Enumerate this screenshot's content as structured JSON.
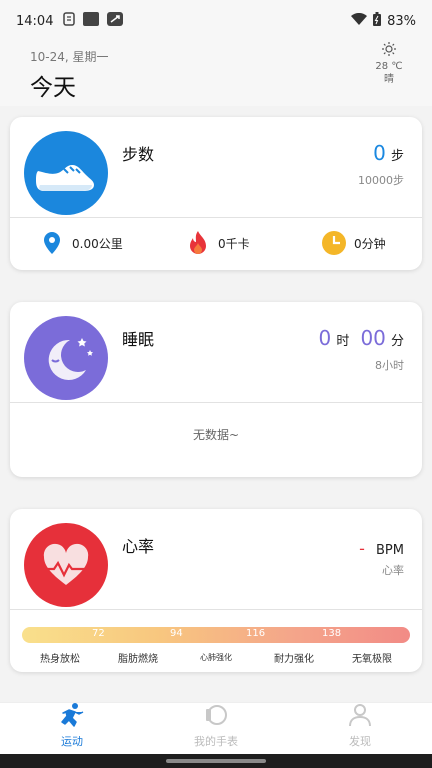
{
  "status_bar": {
    "time": "14:04",
    "battery": "83%"
  },
  "header": {
    "date": "10-24, 星期一",
    "title": "今天",
    "weather": {
      "temp": "28 ℃",
      "condition": "晴",
      "icon": "sun-icon"
    }
  },
  "steps": {
    "title": "步数",
    "value": "0",
    "unit": "步",
    "goal": "10000步",
    "distance": "0.00公里",
    "calories": "0千卡",
    "duration": "0分钟",
    "colors": {
      "accent": "#1a88e0"
    }
  },
  "sleep": {
    "title": "睡眠",
    "hours": "0",
    "hours_unit": "时",
    "minutes": "00",
    "minutes_unit": "分",
    "goal": "8小时",
    "empty_text": "无数据~",
    "colors": {
      "accent": "#7b6cd9"
    }
  },
  "heart_rate": {
    "title": "心率",
    "value": "-",
    "unit": "BPM",
    "label": "心率",
    "thresholds": [
      "72",
      "94",
      "116",
      "138"
    ],
    "zones": [
      "热身放松",
      "脂肪燃烧",
      "心肺强化",
      "耐力强化",
      "无氧极限"
    ],
    "colors": {
      "accent": "#e6303a"
    }
  },
  "tabs": [
    {
      "label": "运动",
      "icon": "running-icon",
      "active": true
    },
    {
      "label": "我的手表",
      "icon": "watch-icon",
      "active": false
    },
    {
      "label": "发现",
      "icon": "person-icon",
      "active": false
    }
  ]
}
